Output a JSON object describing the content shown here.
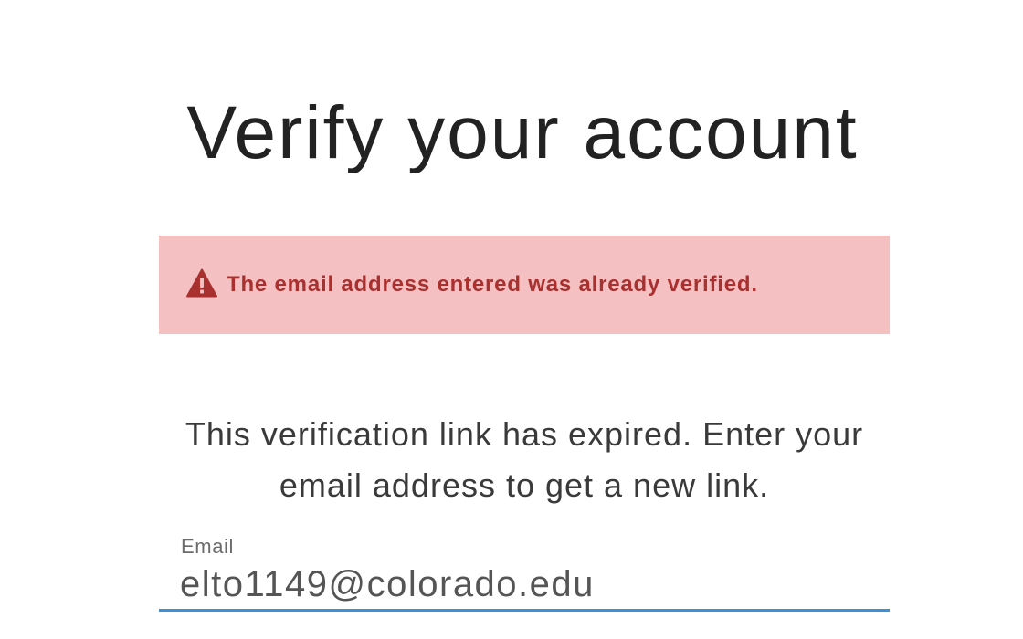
{
  "page": {
    "title": "Verify your account"
  },
  "alert": {
    "icon": "warning-triangle-icon",
    "message": "The email address entered was already verified.",
    "background_color": "#f5c0c2",
    "text_color": "#a8302f"
  },
  "intro": {
    "text": "This verification link has expired. Enter your email address to get a new link."
  },
  "email_field": {
    "label": "Email",
    "value": "elto1149@colorado.edu",
    "focus_color": "#3d8fd6"
  }
}
